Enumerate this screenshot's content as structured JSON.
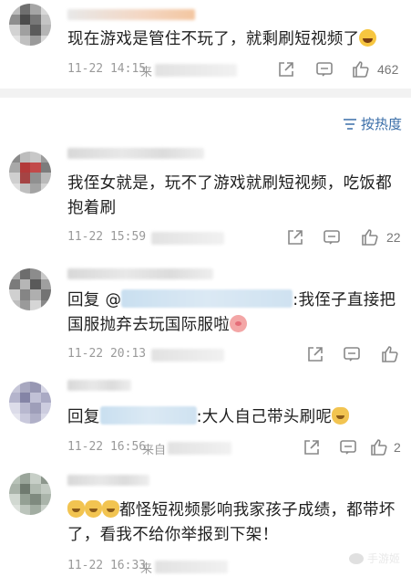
{
  "colors": {
    "link_blue": "#3a6ea8",
    "text": "#1f1f1f",
    "meta_gray": "#9a9a9a",
    "divider": "#f2f2f2"
  },
  "top_comment": {
    "text": "现在游戏是管住不玩了，就剩刷短视频了",
    "time": "11-22 14:15",
    "source_prefix": "来",
    "likes": "462"
  },
  "sort": {
    "label": "按热度",
    "icon": "sort-lines-icon"
  },
  "comments": [
    {
      "text": "我侄女就是，玩不了游戏就刷短视频，吃饭都抱着刷",
      "time": "11-22 15:59",
      "likes": "22"
    },
    {
      "reply_prefix": "回复",
      "at": "@",
      "text_after": ":我侄子直接把国服抛弃去玩国际服啦",
      "time": "11-22 20:13",
      "likes": ""
    },
    {
      "reply_prefix": "回复",
      "text_after": ":大人自己带头刷呢",
      "time": "11-22 16:56",
      "source_prefix": "来自",
      "likes": "2"
    },
    {
      "text": "都怪短视频影响我家孩子成绩，都带坏了，看我不给你举报到下架！",
      "time": "11-22 16:33",
      "source_prefix": "来",
      "likes": ""
    }
  ],
  "icons": {
    "share": "share-icon",
    "comment": "comment-icon",
    "like": "thumbs-up-icon"
  },
  "watermark": "手游姬"
}
